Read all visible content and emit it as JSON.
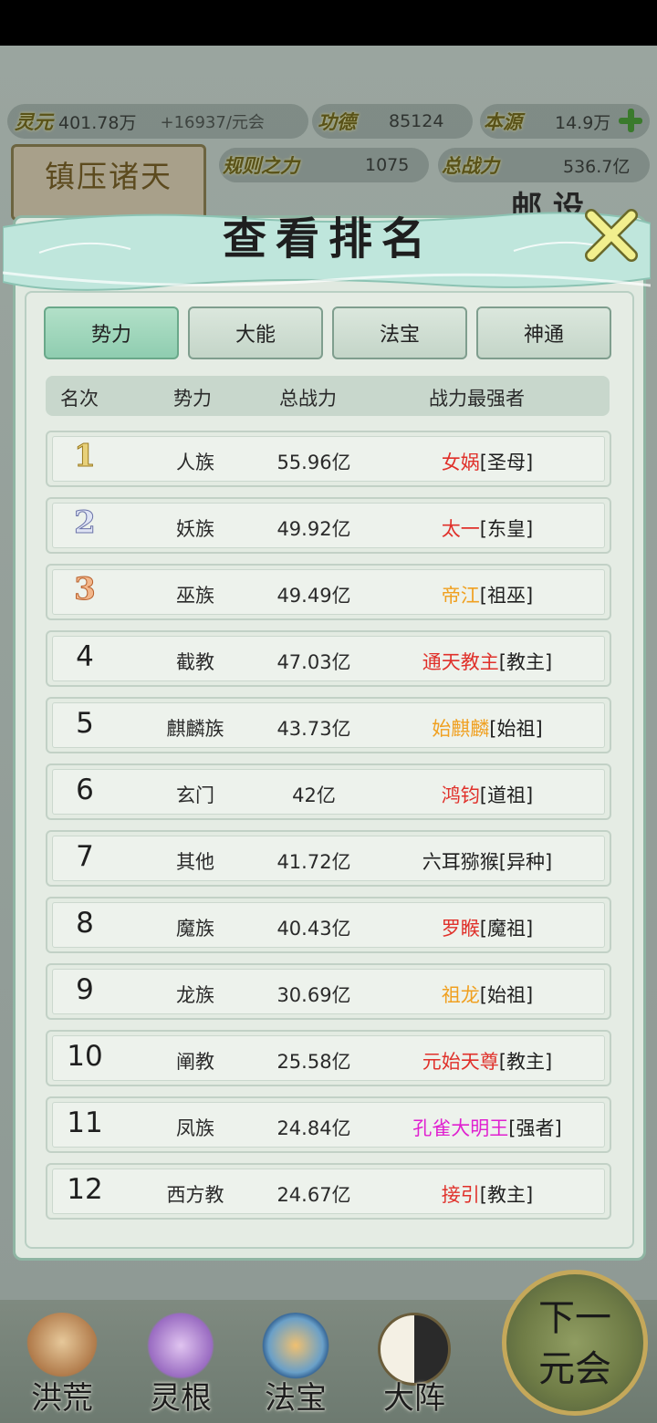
{
  "resources": {
    "lingyuan": {
      "label": "灵元",
      "value": "401.78万",
      "delta": "+16937/元会"
    },
    "gongde": {
      "label": "功德",
      "value": "85124"
    },
    "benyuan": {
      "label": "本源",
      "value": "14.9万"
    },
    "guize": {
      "label": "规则之力",
      "value": "1075"
    },
    "zongzhanli": {
      "label": "总战力",
      "value": "536.7亿"
    }
  },
  "background": {
    "suppress_label": "镇压诸天",
    "mail_text": "邮 设"
  },
  "modal": {
    "title": "查看排名",
    "tabs": [
      {
        "label": "势力",
        "active": true
      },
      {
        "label": "大能",
        "active": false
      },
      {
        "label": "法宝",
        "active": false
      },
      {
        "label": "神通",
        "active": false
      }
    ],
    "columns": [
      "名次",
      "势力",
      "总战力",
      "战力最强者"
    ],
    "rows": [
      {
        "rank": "1",
        "faction": "人族",
        "power": "55.96亿",
        "name": "女娲",
        "tag": "[圣母]",
        "color": "#e0302a"
      },
      {
        "rank": "2",
        "faction": "妖族",
        "power": "49.92亿",
        "name": "太一",
        "tag": "[东皇]",
        "color": "#e0302a"
      },
      {
        "rank": "3",
        "faction": "巫族",
        "power": "49.49亿",
        "name": "帝江",
        "tag": "[祖巫]",
        "color": "#f0a020"
      },
      {
        "rank": "4",
        "faction": "截教",
        "power": "47.03亿",
        "name": "通天教主",
        "tag": "[教主]",
        "color": "#e0302a"
      },
      {
        "rank": "5",
        "faction": "麒麟族",
        "power": "43.73亿",
        "name": "始麒麟",
        "tag": "[始祖]",
        "color": "#f0a020"
      },
      {
        "rank": "6",
        "faction": "玄门",
        "power": "42亿",
        "name": "鸿钧",
        "tag": "[道祖]",
        "color": "#e0302a"
      },
      {
        "rank": "7",
        "faction": "其他",
        "power": "41.72亿",
        "name": "六耳猕猴",
        "tag": "[异种]",
        "color": "#1f1f1f"
      },
      {
        "rank": "8",
        "faction": "魔族",
        "power": "40.43亿",
        "name": "罗睺",
        "tag": "[魔祖]",
        "color": "#e0302a"
      },
      {
        "rank": "9",
        "faction": "龙族",
        "power": "30.69亿",
        "name": "祖龙",
        "tag": "[始祖]",
        "color": "#f0a020"
      },
      {
        "rank": "10",
        "faction": "阐教",
        "power": "25.58亿",
        "name": "元始天尊",
        "tag": "[教主]",
        "color": "#e0302a"
      },
      {
        "rank": "11",
        "faction": "凤族",
        "power": "24.84亿",
        "name": "孔雀大明王",
        "tag": "[强者]",
        "color": "#e020d0"
      },
      {
        "rank": "12",
        "faction": "西方教",
        "power": "24.67亿",
        "name": "接引",
        "tag": "[教主]",
        "color": "#e0302a"
      }
    ]
  },
  "bottom_nav": {
    "items": [
      {
        "label": "洪荒",
        "icon": "mountain-icon"
      },
      {
        "label": "灵根",
        "icon": "lotus-icon"
      },
      {
        "label": "法宝",
        "icon": "treasure-icon"
      },
      {
        "label": "大阵",
        "icon": "yin-yang-icon"
      }
    ],
    "next_line1": "下一",
    "next_line2": "元会"
  }
}
